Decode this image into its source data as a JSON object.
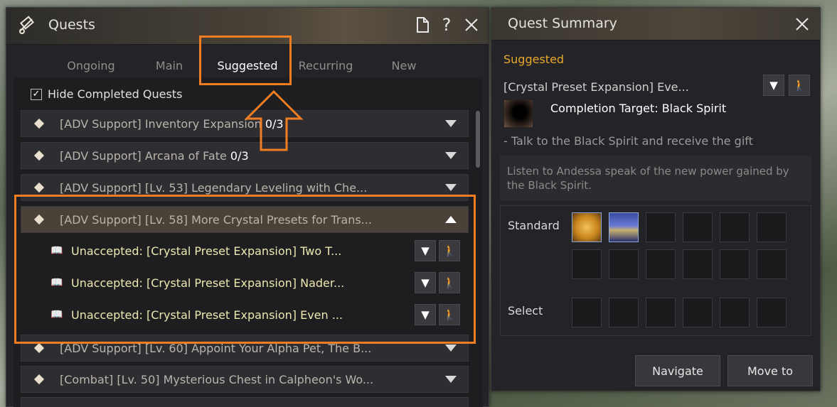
{
  "quests_window": {
    "title": "Quests",
    "tabs": [
      "Ongoing",
      "Main",
      "Suggested",
      "Recurring",
      "New"
    ],
    "active_tab": "Suggested",
    "hide_completed_label": "Hide Completed Quests",
    "hide_completed_checked": true,
    "rows": [
      {
        "label": "[ADV Support] Inventory Expansion ",
        "count": "0/3",
        "expanded": false
      },
      {
        "label": "[ADV Support] Arcana of Fate ",
        "count": "0/3",
        "expanded": false
      },
      {
        "label": "[ADV Support] [Lv. 53] Legendary Leveling with Che...",
        "count": "",
        "expanded": false
      },
      {
        "label": "[ADV Support] [Lv. 58] More Crystal Presets for Trans...",
        "count": "",
        "expanded": true
      },
      {
        "label": "[ADV Support] [Lv. 60] Appoint Your Alpha Pet, The B...",
        "count": "",
        "expanded": false
      },
      {
        "label": "[Combat] [Lv. 50] Mysterious Chest in Calpheon's Wo...",
        "count": "",
        "expanded": false
      }
    ],
    "subquests": [
      "Unaccepted: [Crystal Preset Expansion] Two T...",
      "Unaccepted: [Crystal Preset Expansion] Nader...",
      "Unaccepted: [Crystal Preset Expansion] Even ..."
    ]
  },
  "summary_window": {
    "title": "Quest Summary",
    "category": "Suggested",
    "quest_name": "[Crystal Preset Expansion] Eve...",
    "completion_target": "Completion Target: Black Spirit",
    "objective": "- Talk to the Black Spirit and receive the gift",
    "description": "Listen to Andessa speak of the new power gained by the Black Spirit.",
    "standard_label": "Standard",
    "select_label": "Select",
    "navigate_label": "Navigate",
    "move_label": "Move to"
  },
  "colors": {
    "highlight": "#f07d22",
    "category": "#e7a92a",
    "subquest_text": "#ece8b0"
  }
}
